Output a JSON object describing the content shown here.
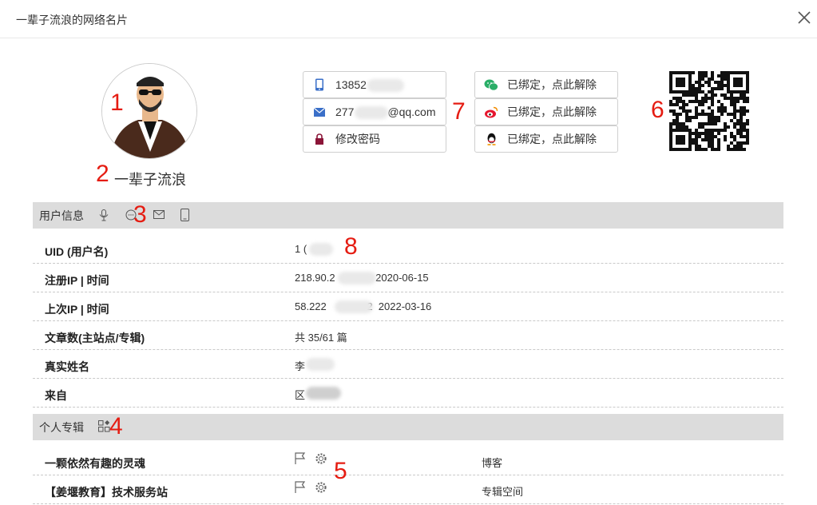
{
  "dialog": {
    "title": "一辈子流浪的网络名片",
    "close_icon": "close-icon"
  },
  "profile": {
    "nickname": "一辈子流浪"
  },
  "annotations": [
    "1",
    "2",
    "3",
    "4",
    "5",
    "6",
    "7",
    "8"
  ],
  "contacts": {
    "phone": "13852",
    "email_prefix": "277",
    "email_suffix": "@qq.com",
    "password": "修改密码"
  },
  "bindings": {
    "wechat": "已绑定，点此解除",
    "weibo": "已绑定，点此解除",
    "qq": "已绑定，点此解除"
  },
  "sections": {
    "user_info": "用户信息",
    "columns": "个人专辑"
  },
  "user_info": [
    {
      "label": "UID (用户名)",
      "value": "1 ("
    },
    {
      "label": "注册IP | 时间",
      "value": "218.90.2              2020-06-15"
    },
    {
      "label": "上次IP | 时间",
      "value": "58.222              2  2022-03-16"
    },
    {
      "label": "文章数(主站点/专辑)",
      "value": "共 35/61 篇"
    },
    {
      "label": "真实姓名",
      "value": "李"
    },
    {
      "label": "来自",
      "value": "区"
    }
  ],
  "albums": [
    {
      "name": "一颗依然有趣的灵魂",
      "type": "博客"
    },
    {
      "name": "【姜堰教育】技术服务站",
      "type": "专辑空间"
    }
  ],
  "colors": {
    "accent_red": "#e51c12",
    "section_bg": "#dcdcdc",
    "wechat_green": "#2aae67",
    "weibo_red": "#e6162d",
    "mail_blue": "#3a6fc8",
    "lock_maroon": "#8b1538"
  }
}
